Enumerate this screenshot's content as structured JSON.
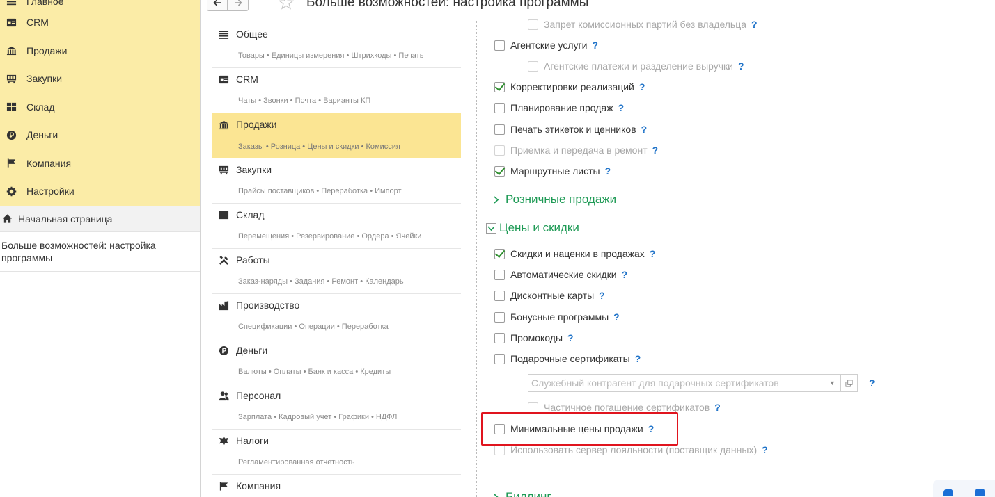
{
  "leftnav": {
    "items": [
      {
        "label": "Главное",
        "icon": "menu-icon"
      },
      {
        "label": "CRM",
        "icon": "crm-icon"
      },
      {
        "label": "Продажи",
        "icon": "sales-icon"
      },
      {
        "label": "Закупки",
        "icon": "purchases-icon"
      },
      {
        "label": "Склад",
        "icon": "warehouse-icon"
      },
      {
        "label": "Деньги",
        "icon": "money-icon"
      },
      {
        "label": "Компания",
        "icon": "flag-icon"
      },
      {
        "label": "Настройки",
        "icon": "gear-icon"
      }
    ],
    "home_label": "Начальная страница",
    "open_window": "Больше возможностей: настройка программы"
  },
  "header": {
    "title": "Больше возможностей: настройка программы"
  },
  "sections": [
    {
      "title": "Общее",
      "subtitle": "Товары • Единицы измерения • Штрихкоды • Печать",
      "icon": "list-icon"
    },
    {
      "title": "CRM",
      "subtitle": "Чаты • Звонки • Почта • Варианты КП",
      "icon": "crm-icon"
    },
    {
      "title": "Продажи",
      "subtitle": "Заказы • Розница • Цены и скидки • Комиссия",
      "icon": "sales-icon",
      "active": true
    },
    {
      "title": "Закупки",
      "subtitle": "Прайсы поставщиков • Переработка • Импорт",
      "icon": "purchases-icon"
    },
    {
      "title": "Склад",
      "subtitle": "Перемещения • Резервирование • Ордера • Ячейки",
      "icon": "warehouse-icon"
    },
    {
      "title": "Работы",
      "subtitle": "Заказ-наряды • Задания • Ремонт • Календарь",
      "icon": "tools-icon"
    },
    {
      "title": "Производство",
      "subtitle": "Спецификации • Операции • Переработка",
      "icon": "factory-icon"
    },
    {
      "title": "Деньги",
      "subtitle": "Валюты • Оплаты • Банк и касса • Кредиты",
      "icon": "money-icon"
    },
    {
      "title": "Персонал",
      "subtitle": "Зарплата • Кадровый учет • Графики • НДФЛ",
      "icon": "people-icon"
    },
    {
      "title": "Налоги",
      "subtitle": "Регламентированная отчетность",
      "icon": "emblem-icon"
    },
    {
      "title": "Компания",
      "subtitle": "",
      "icon": "flag-icon"
    }
  ],
  "options": {
    "no_owner_commission": "Запрет комиссионных партий без владельца",
    "agent_services": "Агентские услуги",
    "agent_payments": "Агентские платежи и разделение выручки",
    "sales_corrections": "Корректировки реализаций",
    "sales_planning": "Планирование продаж",
    "label_printing": "Печать этикеток и ценников",
    "repair_handover": "Приемка и передача в ремонт",
    "route_sheets": "Маршрутные листы",
    "retail_group": "Розничные продажи",
    "prices_group": "Цены и скидки",
    "discounts_markups": "Скидки и наценки в продажах",
    "auto_discounts": "Автоматические скидки",
    "discount_cards": "Дисконтные карты",
    "bonus_programs": "Бонусные программы",
    "promo_codes": "Промокоды",
    "gift_certificates": "Подарочные сертификаты",
    "service_counterparty_placeholder": "Служебный контрагент для подарочных сертификатов",
    "partial_redemption": "Частичное погашение сертификатов",
    "min_sale_prices": "Минимальные цены продажи",
    "loyalty_server": "Использовать сервер лояльности (поставщик данных)",
    "billing_group": "Биллинг",
    "help_mark": "?"
  }
}
